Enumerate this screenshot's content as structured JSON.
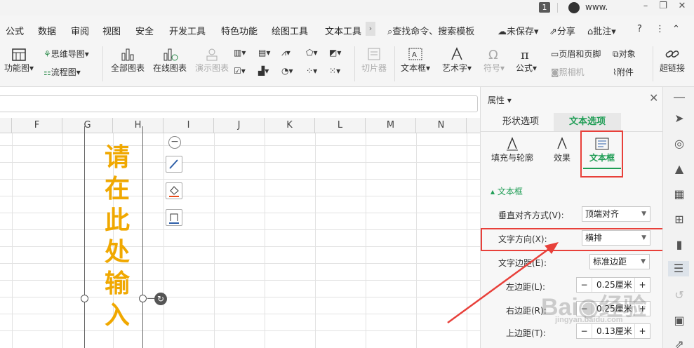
{
  "titlebar": {
    "badge": "1",
    "user": "www."
  },
  "menu": {
    "tabs": [
      "公式",
      "数据",
      "审阅",
      "视图",
      "安全",
      "开发工具",
      "特色功能",
      "绘图工具",
      "文本工具"
    ],
    "search": "查找命令、搜索模板",
    "unsaved": "未保存",
    "share": "分享",
    "comment": "批注",
    "help": "?"
  },
  "ribbon": {
    "functions_label": "功能图",
    "mindmap": "思维导图",
    "flowchart": "流程图",
    "all_charts": "全部图表",
    "online_charts": "在线图表",
    "demo_charts": "演示图表",
    "slicer": "切片器",
    "textbox": "文本框",
    "wordart": "艺术字",
    "symbol": "符号",
    "formula": "公式",
    "header_footer": "页眉和页脚",
    "object": "对象",
    "camera": "照相机",
    "attachment": "附件",
    "hyperlink": "超链接"
  },
  "sheet": {
    "columns": [
      "F",
      "G",
      "H",
      "I",
      "J",
      "K",
      "L",
      "M",
      "N"
    ],
    "vertical_text": "请在此处输入"
  },
  "panel": {
    "title": "属性",
    "tabs": [
      "形状选项",
      "文本选项"
    ],
    "subtabs": [
      "填充与轮廓",
      "效果",
      "文本框"
    ],
    "section": "文本框",
    "valign_label": "垂直对齐方式(V):",
    "valign_value": "顶端对齐",
    "direction_label": "文字方向(X):",
    "direction_value": "横排",
    "margin_label": "文字边距(E):",
    "margin_value": "标准边距",
    "left_label": "左边距(L):",
    "left_value": "0.25厘米",
    "right_label": "右边距(R):",
    "right_value": "0.25厘米",
    "top_label": "上边距(T):",
    "top_value": "0.13厘米"
  },
  "colors": {
    "accent": "#e8403a",
    "text_orange": "#f0a800",
    "tab_green": "#1f9d55"
  }
}
